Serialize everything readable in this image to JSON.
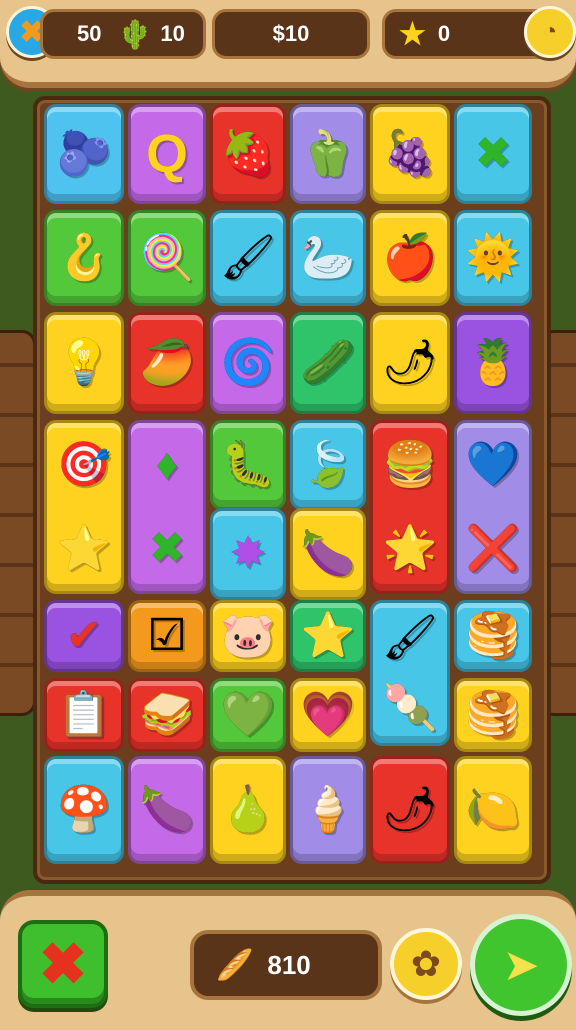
{
  "hud": {
    "close_icon": "x-icon",
    "moves_value": "50",
    "creature_icon": "cactus-critter-icon",
    "creature_value": "10",
    "center_value": "$10",
    "star_value": "0",
    "currency_icon": "coin-icon"
  },
  "colors": {
    "blue": "#4fc3f0",
    "purple": "#c46ae8",
    "red": "#e8332a",
    "lavender": "#a18de8",
    "yellow": "#ffd21f",
    "cyan": "#47c6e8",
    "green": "#53c83a",
    "violet": "#9a52e0",
    "orange": "#f39a1d",
    "teal": "#2fc46a"
  },
  "tiles": [
    {
      "id": "r1c1",
      "color": "blue",
      "icon": "potion-icon",
      "glyph": "🫐"
    },
    {
      "id": "r1c2",
      "color": "purple",
      "icon": "letter-q-icon",
      "glyph": "Q"
    },
    {
      "id": "r1c3",
      "color": "red",
      "icon": "strawberry-icon",
      "glyph": "🍓"
    },
    {
      "id": "r1c4",
      "color": "lavender",
      "icon": "bell-pepper-icon",
      "glyph": "🫑"
    },
    {
      "id": "r1c5",
      "color": "yellow",
      "icon": "plum-icon",
      "glyph": "🍇"
    },
    {
      "id": "r1c6",
      "color": "cyan",
      "icon": "cross-icon",
      "glyph": "✖"
    },
    {
      "id": "r2c1",
      "color": "green",
      "icon": "hook-icon",
      "glyph": "🪝"
    },
    {
      "id": "r2c2",
      "color": "green",
      "icon": "lollipop-icon",
      "glyph": "🍭"
    },
    {
      "id": "r2c3",
      "color": "cyan",
      "icon": "brush-icon",
      "glyph": "🖌"
    },
    {
      "id": "r2c4",
      "color": "cyan",
      "icon": "swan-icon",
      "glyph": "🦢"
    },
    {
      "id": "r2c5",
      "color": "yellow",
      "icon": "apple-icon",
      "glyph": "🍎"
    },
    {
      "id": "r2c6",
      "color": "cyan",
      "icon": "sun-face-icon",
      "glyph": "🌞"
    },
    {
      "id": "r3c1",
      "color": "yellow",
      "icon": "bulb-icon",
      "glyph": "💡"
    },
    {
      "id": "r3c2",
      "color": "red",
      "icon": "mango-icon",
      "glyph": "🥭"
    },
    {
      "id": "r3c3",
      "color": "purple",
      "icon": "swirl-icon",
      "glyph": "🌀"
    },
    {
      "id": "r3c4",
      "color": "teal",
      "icon": "gourd-icon",
      "glyph": "🥒"
    },
    {
      "id": "r3c5",
      "color": "yellow",
      "icon": "radish-icon",
      "glyph": "🌶"
    },
    {
      "id": "r3c6",
      "color": "violet",
      "icon": "popsicle-icon",
      "glyph": "🍍"
    },
    {
      "id": "r4c1",
      "color": "yellow",
      "icon": "target-icon",
      "glyph": "🎯",
      "glyph2": "⭐",
      "tall": true
    },
    {
      "id": "r4c2",
      "color": "purple",
      "icon": "diamond-icon",
      "glyph": "♦",
      "glyph2": "✖",
      "tall": true
    },
    {
      "id": "r4c3",
      "color": "green",
      "icon": "worm-icon",
      "glyph": "🐛"
    },
    {
      "id": "r4c4",
      "color": "cyan",
      "icon": "leaf-icon",
      "glyph": "🍃"
    },
    {
      "id": "r4c5",
      "color": "red",
      "icon": "macaron-icon",
      "glyph": "🍔",
      "glyph2": "🌟",
      "tall": true
    },
    {
      "id": "r4c6",
      "color": "lavender",
      "icon": "heart-blob-icon",
      "glyph": "💙",
      "glyph2": "❌",
      "tall": true
    },
    {
      "id": "r5c3",
      "color": "cyan",
      "icon": "splat-icon",
      "glyph": "✸"
    },
    {
      "id": "r5c4",
      "color": "yellow",
      "icon": "eggplant-icon",
      "glyph": "🍆"
    },
    {
      "id": "r6c1",
      "color": "violet",
      "icon": "check-icon",
      "glyph": "✔"
    },
    {
      "id": "r6c2",
      "color": "orange",
      "icon": "checkbox-icon",
      "glyph": "☑"
    },
    {
      "id": "r6c3",
      "color": "yellow",
      "icon": "blob-icon",
      "glyph": "🐷"
    },
    {
      "id": "r6c4",
      "color": "teal",
      "icon": "star-icon",
      "glyph": "⭐"
    },
    {
      "id": "r6c5",
      "color": "cyan",
      "icon": "candy-stick-icon",
      "glyph": "🖌",
      "glyph2": "🍡",
      "tall": true
    },
    {
      "id": "r6c6",
      "color": "cyan",
      "icon": "stack-icon",
      "glyph": "🥞"
    },
    {
      "id": "r7c1",
      "color": "red",
      "icon": "note-icon",
      "glyph": "📋"
    },
    {
      "id": "r7c2",
      "color": "red",
      "icon": "sandwich-icon",
      "glyph": "🥪"
    },
    {
      "id": "r7c3",
      "color": "green",
      "icon": "heart-icon",
      "glyph": "💚"
    },
    {
      "id": "r7c4",
      "color": "yellow",
      "icon": "heart-icon",
      "glyph": "💗"
    },
    {
      "id": "r7c6",
      "color": "yellow",
      "icon": "pancake-icon",
      "glyph": "🥞"
    },
    {
      "id": "r8c1",
      "color": "cyan",
      "icon": "mushroom-icon",
      "glyph": "🍄"
    },
    {
      "id": "r8c2",
      "color": "purple",
      "icon": "grape-icon",
      "glyph": "🍆"
    },
    {
      "id": "r8c3",
      "color": "yellow",
      "icon": "pear-icon",
      "glyph": "🍐"
    },
    {
      "id": "r8c4",
      "color": "lavender",
      "icon": "popsicle-icon",
      "glyph": "🍦"
    },
    {
      "id": "r8c5",
      "color": "red",
      "icon": "pepper-icon",
      "glyph": "🌶"
    },
    {
      "id": "r8c6",
      "color": "yellow",
      "icon": "lemon-icon",
      "glyph": "🍋"
    }
  ],
  "bottom": {
    "coin_value": "810",
    "quit_icon": "x-icon",
    "settings_icon": "gear-icon",
    "play_icon": "send-arrow-icon"
  }
}
